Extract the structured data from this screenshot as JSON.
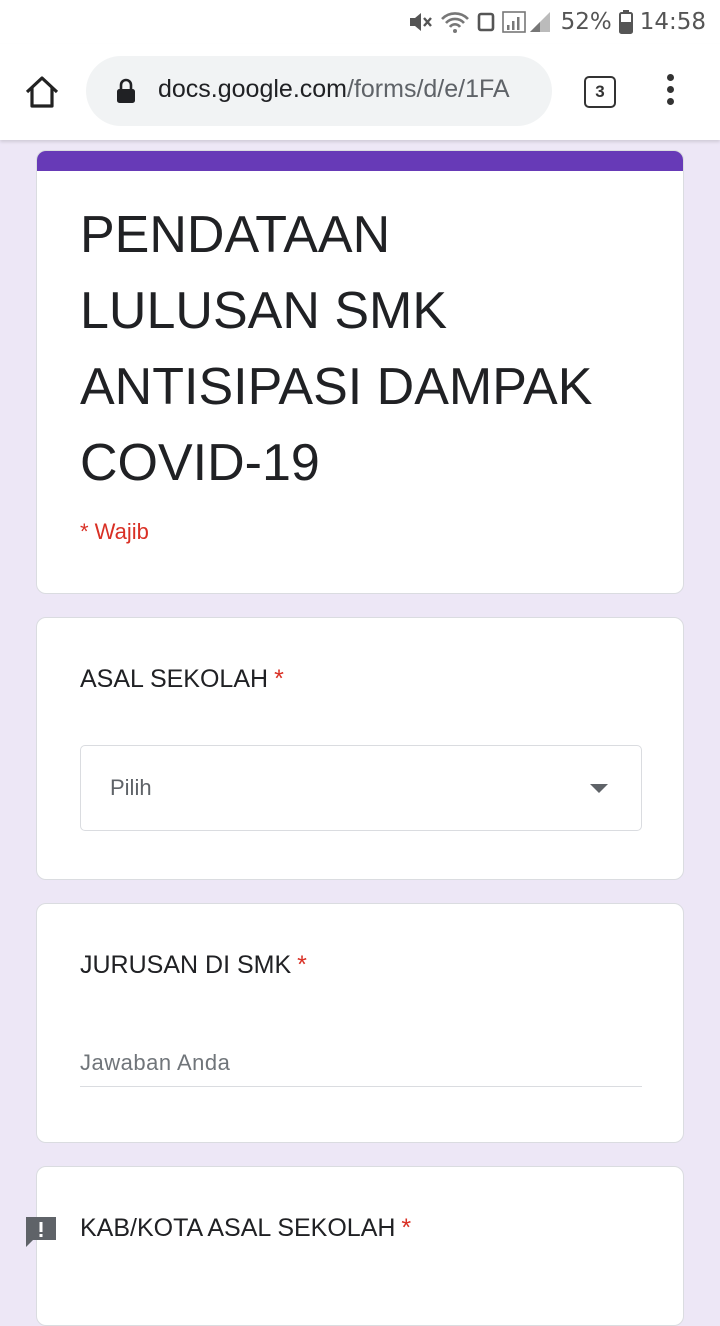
{
  "status_bar": {
    "battery": "52%",
    "time": "14:58"
  },
  "browser": {
    "url_host": "docs.google.com",
    "url_path": "/forms/d/e/1FA",
    "tab_count": "3"
  },
  "form": {
    "title": "PENDATAAN LULUSAN SMK ANTISIPASI DAMPAK COVID-19",
    "required_note": "* Wajib",
    "accent_color": "#673ab7",
    "questions": [
      {
        "label": "ASAL SEKOLAH",
        "required_mark": "*",
        "type": "dropdown",
        "selected": "Pilih"
      },
      {
        "label": "JURUSAN DI SMK",
        "required_mark": "*",
        "type": "short-answer",
        "placeholder": "Jawaban Anda"
      },
      {
        "label": "KAB/KOTA ASAL SEKOLAH",
        "required_mark": "*",
        "type": "unknown"
      }
    ]
  },
  "icons": {
    "home": "home-icon",
    "lock": "lock-icon",
    "menu": "more-vert-icon",
    "feedback": "feedback-icon",
    "mute": "mute-icon",
    "wifi": "wifi-icon",
    "signal": "signal-icon",
    "battery": "battery-icon"
  }
}
